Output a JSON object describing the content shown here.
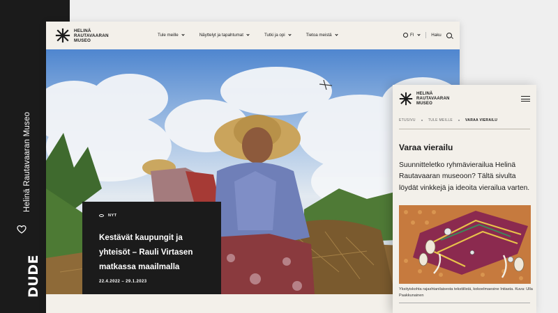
{
  "agency": {
    "site_name": "Helinä Rautavaaran Museo",
    "logo_text": "DUDE"
  },
  "brand": {
    "line1": "HELINÄ",
    "line2": "RAUTAVAARAN",
    "line3": "MUSEO"
  },
  "desktop": {
    "nav": [
      {
        "label": "Tule meille"
      },
      {
        "label": "Näyttelyt ja tapahtumat"
      },
      {
        "label": "Tutki ja opi"
      },
      {
        "label": "Tietoa meistä"
      }
    ],
    "language": "FI",
    "search_label": "Haku",
    "news": {
      "tag": "NYT",
      "title": "Kestävät kaupungit ja yhteisöt – Rauli Virtasen matkassa maailmalla",
      "date": "22.4.2022 – 29.1.2023"
    }
  },
  "mobile": {
    "breadcrumbs": [
      "ETUSIVU",
      "TULE MEILLE",
      "VARAA VIERAILU"
    ],
    "heading": "Varaa vierailu",
    "lead": "Suunnitteletko ryhmävierailua Helinä Rautavaaran museoon? Tältä sivulta löydät vinkkejä ja ideoita vierailua varten.",
    "caption": "Yksityiskohta rajashtanilaisesta tekstiilistä, kokoelmaesine Intiasta. Kuva: Ulla Paakkunainen"
  },
  "colors": {
    "dark": "#1b1b1b",
    "paper": "#f3f0ea",
    "background": "#efefef"
  }
}
